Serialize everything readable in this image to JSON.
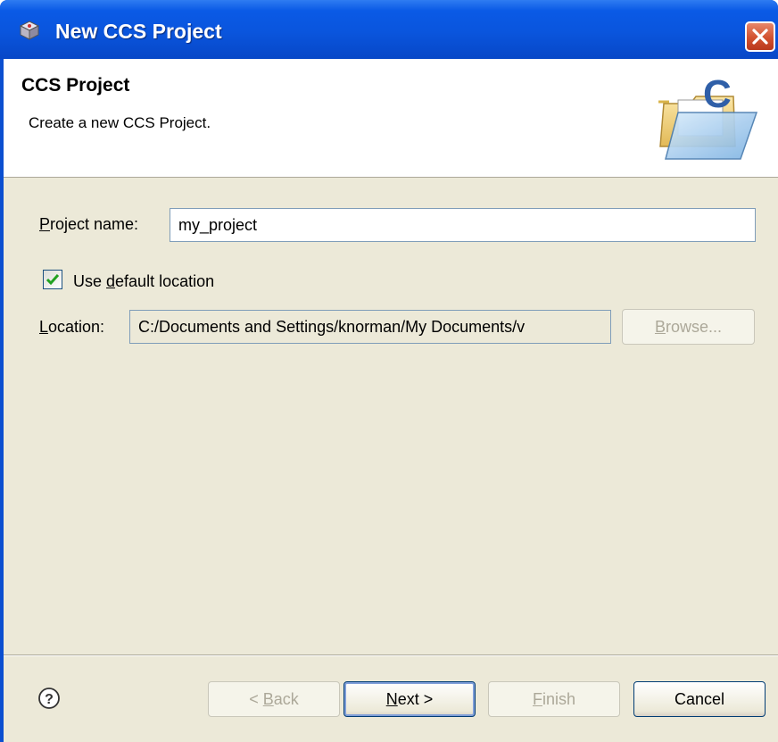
{
  "window": {
    "title": "New CCS Project",
    "close_icon": "close-icon",
    "app_icon": "ccs-app-icon"
  },
  "banner": {
    "title": "CCS Project",
    "description": "Create a new CCS Project.",
    "icon": "folder-c-icon"
  },
  "form": {
    "project_name_label": "Project name:",
    "project_name_value": "my_project",
    "use_default_label": "Use default location",
    "use_default_checked": true,
    "location_label": "Location:",
    "location_value": "C:/Documents and Settings/knorman/My Documents/v",
    "browse_label": "Browse..."
  },
  "footer": {
    "help_icon": "help-icon",
    "back_label": "< Back",
    "next_label": "Next >",
    "finish_label": "Finish",
    "cancel_label": "Cancel"
  },
  "colors": {
    "titlebar": "#0a55dd",
    "dialog_bg": "#ece9d8",
    "close_button": "#d2512f",
    "checkmark": "#21a121"
  }
}
